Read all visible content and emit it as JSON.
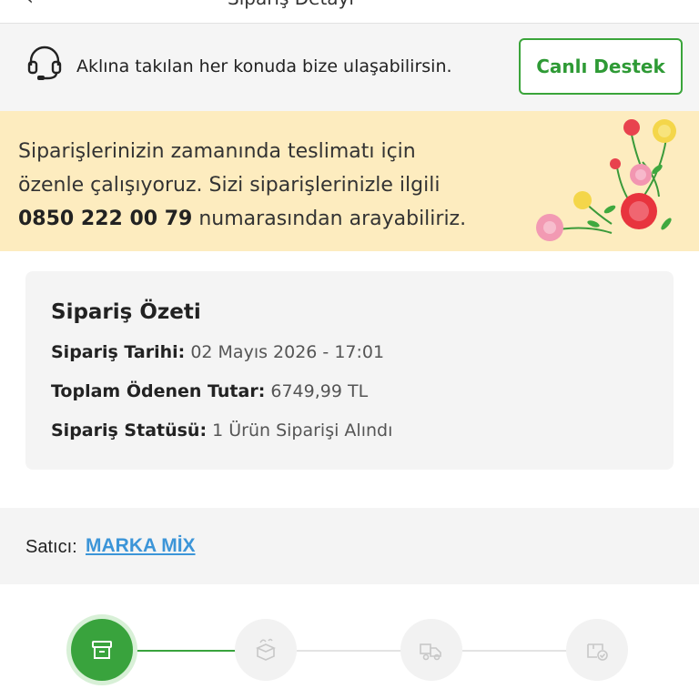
{
  "topbar": {
    "back_glyph": "‹",
    "title": "Sipariş Detayı"
  },
  "support": {
    "icon": "headset-icon",
    "text": "Aklına takılan her konuda bize ulaşabilirsin.",
    "button_label": "Canlı Destek"
  },
  "notice": {
    "line1": "Siparişlerinizin zamanında teslimatı için",
    "line2": "özenle çalışıyoruz. Sizi siparişlerinizle ilgili",
    "phone": "0850 222 00 79",
    "line3_rest": " numarasından arayabiliriz.",
    "decoration": "flowers-illustration"
  },
  "summary": {
    "heading": "Sipariş Özeti",
    "date_label": "Sipariş Tarihi:",
    "date_value": " 02 Mayıs 2026 - 17:01",
    "total_label": "Toplam Ödenen Tutar:",
    "total_value": " 6749,99 TL",
    "status_label": "Sipariş Statüsü:",
    "status_value": " 1 Ürün Siparişi Alındı"
  },
  "seller": {
    "label": "Satıcı:",
    "name": "MARKA MİX"
  },
  "steps": [
    {
      "icon": "box-icon",
      "state": "active"
    },
    {
      "icon": "open-box-icon",
      "state": "inactive"
    },
    {
      "icon": "delivery-truck-icon",
      "state": "inactive"
    },
    {
      "icon": "delivered-check-icon",
      "state": "inactive"
    }
  ],
  "colors": {
    "accent": "#39a33d",
    "notice_bg": "#fdecbf",
    "link": "#3c95d8"
  }
}
